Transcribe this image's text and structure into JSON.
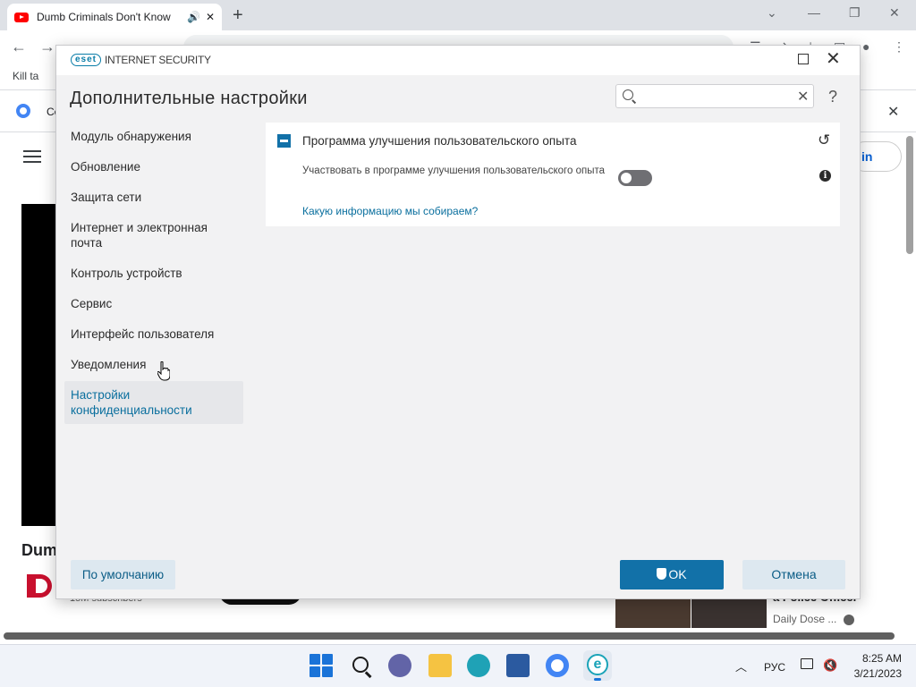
{
  "browser": {
    "tab_title": "Dumb Criminals Don't Know",
    "new_tab_glyph": "+",
    "window_controls": [
      "⌄",
      "—",
      "❐",
      "✕"
    ],
    "bookmark_text": "Kill ta",
    "infobar_text": "Ce"
  },
  "youtube": {
    "signin_text": "in",
    "video_title": "Dum",
    "subscribers": "15M subscribers",
    "side_title": "a Police Officer",
    "side_channel": "Daily Dose ..."
  },
  "eset": {
    "logo": "eset",
    "product": "INTERNET SECURITY",
    "heading": "Дополнительные настройки",
    "search_placeholder": "",
    "help_glyph": "?",
    "nav_items": [
      "Модуль обнаружения",
      "Обновление",
      "Защита сети",
      "Интернет и электронная почта",
      "Контроль устройств",
      "Сервис",
      "Интерфейс пользователя",
      "Уведомления",
      "Настройки конфиденциальности"
    ],
    "active_nav_index": 8,
    "section": {
      "title": "Программа улучшения пользовательского опыта",
      "setting_label": "Участвовать в программе улучшения пользовательского опыта",
      "toggle_on": false,
      "link": "Какую информацию мы собираем?"
    },
    "buttons": {
      "default": "По умолчанию",
      "ok": "OK",
      "cancel": "Отмена"
    },
    "colors": {
      "accent": "#1271a8",
      "link": "#0a6f9e",
      "secondary_button": "#dde8f0"
    }
  },
  "taskbar": {
    "language": "РУС",
    "time": "8:25 AM",
    "date": "3/21/2023",
    "pinned_icons": [
      "start-icon",
      "search-icon",
      "teams-chat-icon",
      "file-explorer-icon",
      "edge-icon",
      "store-icon",
      "chrome-icon",
      "eset-icon"
    ]
  }
}
